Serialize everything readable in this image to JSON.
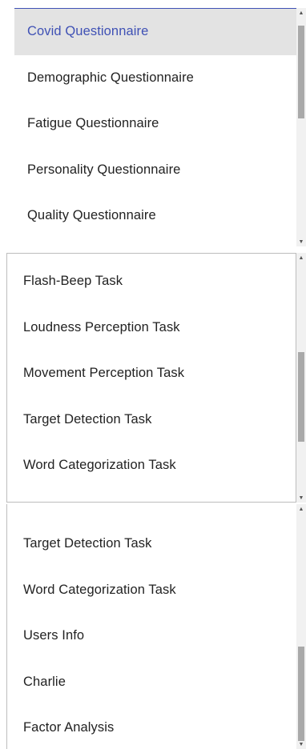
{
  "dropdown_1": {
    "items": [
      {
        "label": "Covid Questionnaire",
        "selected": true
      },
      {
        "label": "Demographic Questionnaire",
        "selected": false
      },
      {
        "label": "Fatigue Questionnaire",
        "selected": false
      },
      {
        "label": "Personality Questionnaire",
        "selected": false
      },
      {
        "label": "Quality Questionnaire",
        "selected": false
      }
    ]
  },
  "dropdown_2": {
    "items": [
      {
        "label": "Flash-Beep Task"
      },
      {
        "label": "Loudness Perception Task"
      },
      {
        "label": "Movement Perception Task"
      },
      {
        "label": "Target Detection Task"
      },
      {
        "label": "Word Categorization Task"
      }
    ]
  },
  "dropdown_3": {
    "items": [
      {
        "label": "Target Detection Task"
      },
      {
        "label": "Word Categorization Task"
      },
      {
        "label": "Users Info"
      },
      {
        "label": "Charlie"
      },
      {
        "label": "Factor Analysis"
      }
    ]
  },
  "colors": {
    "accent": "#3f51b5",
    "selected_background": "#e3e3e3",
    "scrollbar_thumb": "#a9a9a9"
  }
}
